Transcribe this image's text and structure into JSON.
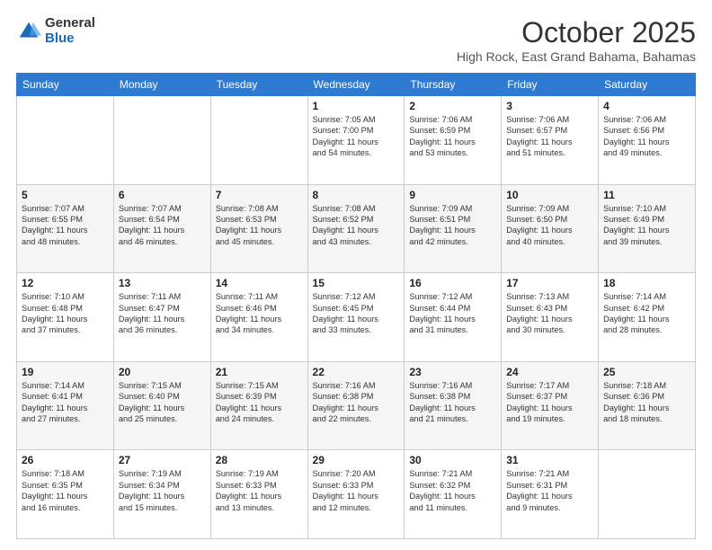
{
  "logo": {
    "general": "General",
    "blue": "Blue"
  },
  "header": {
    "month": "October 2025",
    "subtitle": "High Rock, East Grand Bahama, Bahamas"
  },
  "days_of_week": [
    "Sunday",
    "Monday",
    "Tuesday",
    "Wednesday",
    "Thursday",
    "Friday",
    "Saturday"
  ],
  "weeks": [
    [
      {
        "num": "",
        "info": ""
      },
      {
        "num": "",
        "info": ""
      },
      {
        "num": "",
        "info": ""
      },
      {
        "num": "1",
        "info": "Sunrise: 7:05 AM\nSunset: 7:00 PM\nDaylight: 11 hours\nand 54 minutes."
      },
      {
        "num": "2",
        "info": "Sunrise: 7:06 AM\nSunset: 6:59 PM\nDaylight: 11 hours\nand 53 minutes."
      },
      {
        "num": "3",
        "info": "Sunrise: 7:06 AM\nSunset: 6:57 PM\nDaylight: 11 hours\nand 51 minutes."
      },
      {
        "num": "4",
        "info": "Sunrise: 7:06 AM\nSunset: 6:56 PM\nDaylight: 11 hours\nand 49 minutes."
      }
    ],
    [
      {
        "num": "5",
        "info": "Sunrise: 7:07 AM\nSunset: 6:55 PM\nDaylight: 11 hours\nand 48 minutes."
      },
      {
        "num": "6",
        "info": "Sunrise: 7:07 AM\nSunset: 6:54 PM\nDaylight: 11 hours\nand 46 minutes."
      },
      {
        "num": "7",
        "info": "Sunrise: 7:08 AM\nSunset: 6:53 PM\nDaylight: 11 hours\nand 45 minutes."
      },
      {
        "num": "8",
        "info": "Sunrise: 7:08 AM\nSunset: 6:52 PM\nDaylight: 11 hours\nand 43 minutes."
      },
      {
        "num": "9",
        "info": "Sunrise: 7:09 AM\nSunset: 6:51 PM\nDaylight: 11 hours\nand 42 minutes."
      },
      {
        "num": "10",
        "info": "Sunrise: 7:09 AM\nSunset: 6:50 PM\nDaylight: 11 hours\nand 40 minutes."
      },
      {
        "num": "11",
        "info": "Sunrise: 7:10 AM\nSunset: 6:49 PM\nDaylight: 11 hours\nand 39 minutes."
      }
    ],
    [
      {
        "num": "12",
        "info": "Sunrise: 7:10 AM\nSunset: 6:48 PM\nDaylight: 11 hours\nand 37 minutes."
      },
      {
        "num": "13",
        "info": "Sunrise: 7:11 AM\nSunset: 6:47 PM\nDaylight: 11 hours\nand 36 minutes."
      },
      {
        "num": "14",
        "info": "Sunrise: 7:11 AM\nSunset: 6:46 PM\nDaylight: 11 hours\nand 34 minutes."
      },
      {
        "num": "15",
        "info": "Sunrise: 7:12 AM\nSunset: 6:45 PM\nDaylight: 11 hours\nand 33 minutes."
      },
      {
        "num": "16",
        "info": "Sunrise: 7:12 AM\nSunset: 6:44 PM\nDaylight: 11 hours\nand 31 minutes."
      },
      {
        "num": "17",
        "info": "Sunrise: 7:13 AM\nSunset: 6:43 PM\nDaylight: 11 hours\nand 30 minutes."
      },
      {
        "num": "18",
        "info": "Sunrise: 7:14 AM\nSunset: 6:42 PM\nDaylight: 11 hours\nand 28 minutes."
      }
    ],
    [
      {
        "num": "19",
        "info": "Sunrise: 7:14 AM\nSunset: 6:41 PM\nDaylight: 11 hours\nand 27 minutes."
      },
      {
        "num": "20",
        "info": "Sunrise: 7:15 AM\nSunset: 6:40 PM\nDaylight: 11 hours\nand 25 minutes."
      },
      {
        "num": "21",
        "info": "Sunrise: 7:15 AM\nSunset: 6:39 PM\nDaylight: 11 hours\nand 24 minutes."
      },
      {
        "num": "22",
        "info": "Sunrise: 7:16 AM\nSunset: 6:38 PM\nDaylight: 11 hours\nand 22 minutes."
      },
      {
        "num": "23",
        "info": "Sunrise: 7:16 AM\nSunset: 6:38 PM\nDaylight: 11 hours\nand 21 minutes."
      },
      {
        "num": "24",
        "info": "Sunrise: 7:17 AM\nSunset: 6:37 PM\nDaylight: 11 hours\nand 19 minutes."
      },
      {
        "num": "25",
        "info": "Sunrise: 7:18 AM\nSunset: 6:36 PM\nDaylight: 11 hours\nand 18 minutes."
      }
    ],
    [
      {
        "num": "26",
        "info": "Sunrise: 7:18 AM\nSunset: 6:35 PM\nDaylight: 11 hours\nand 16 minutes."
      },
      {
        "num": "27",
        "info": "Sunrise: 7:19 AM\nSunset: 6:34 PM\nDaylight: 11 hours\nand 15 minutes."
      },
      {
        "num": "28",
        "info": "Sunrise: 7:19 AM\nSunset: 6:33 PM\nDaylight: 11 hours\nand 13 minutes."
      },
      {
        "num": "29",
        "info": "Sunrise: 7:20 AM\nSunset: 6:33 PM\nDaylight: 11 hours\nand 12 minutes."
      },
      {
        "num": "30",
        "info": "Sunrise: 7:21 AM\nSunset: 6:32 PM\nDaylight: 11 hours\nand 11 minutes."
      },
      {
        "num": "31",
        "info": "Sunrise: 7:21 AM\nSunset: 6:31 PM\nDaylight: 11 hours\nand 9 minutes."
      },
      {
        "num": "",
        "info": ""
      }
    ]
  ]
}
